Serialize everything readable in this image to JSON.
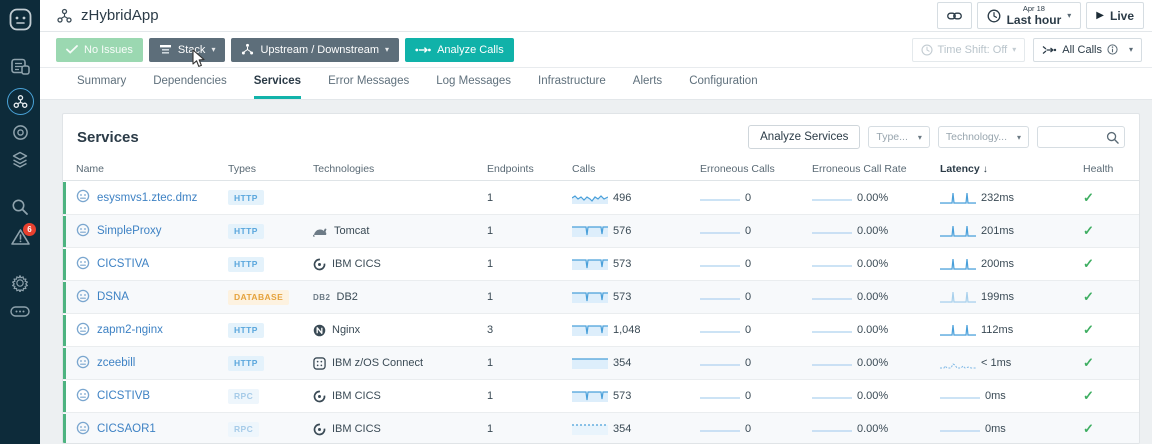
{
  "app": {
    "title": "zHybridApp"
  },
  "sidebar": {
    "icons": [
      "instana-logo",
      "dashboards-icon",
      "applications-icon",
      "websites-icon",
      "platform-icon",
      "analytics-icon",
      "events-icon",
      "settings-icon",
      "more-icon"
    ],
    "active_item": "applications",
    "events_badge": "6"
  },
  "topbar": {
    "link_icon": "link-icon",
    "time_date": "Apr 18",
    "time_range": "Last hour",
    "live_label": "Live"
  },
  "toolbar": {
    "no_issues_label": "No Issues",
    "stack_label": "Stack",
    "upstream_label": "Upstream / Downstream",
    "analyze_calls_label": "Analyze Calls",
    "time_shift_label": "Time Shift: Off",
    "all_calls_label": "All Calls"
  },
  "tabs": [
    {
      "label": "Summary",
      "active": false
    },
    {
      "label": "Dependencies",
      "active": false
    },
    {
      "label": "Services",
      "active": true
    },
    {
      "label": "Error Messages",
      "active": false
    },
    {
      "label": "Log Messages",
      "active": false
    },
    {
      "label": "Infrastructure",
      "active": false
    },
    {
      "label": "Alerts",
      "active": false
    },
    {
      "label": "Configuration",
      "active": false
    }
  ],
  "services_panel": {
    "title": "Services",
    "analyze_button": "Analyze Services",
    "type_filter_placeholder": "Type...",
    "technology_filter_placeholder": "Technology...",
    "columns": [
      "Name",
      "Types",
      "Technologies",
      "Endpoints",
      "Calls",
      "Erroneous Calls",
      "Erroneous Call Rate",
      "Latency",
      "Health"
    ],
    "sort_column": "Latency",
    "sort_direction": "desc",
    "rows": [
      {
        "name": "esysmvs1.ztec.dmz",
        "type": "HTTP",
        "type_kind": "http",
        "technology": "",
        "tech_icon": "",
        "endpoints": "1",
        "calls": "496",
        "calls_spark": "wavy",
        "erroneous_calls": "0",
        "erroneous_call_rate": "0.00%",
        "latency": "232ms",
        "latency_spark": "spikes",
        "health": "ok"
      },
      {
        "name": "SimpleProxy",
        "type": "HTTP",
        "type_kind": "http",
        "technology": "Tomcat",
        "tech_icon": "tomcat-icon",
        "endpoints": "1",
        "calls": "576",
        "calls_spark": "notch",
        "erroneous_calls": "0",
        "erroneous_call_rate": "0.00%",
        "latency": "201ms",
        "latency_spark": "spikes",
        "health": "ok"
      },
      {
        "name": "CICSTIVA",
        "type": "HTTP",
        "type_kind": "http",
        "technology": "IBM CICS",
        "tech_icon": "ibm-cics-icon",
        "endpoints": "1",
        "calls": "573",
        "calls_spark": "notch",
        "erroneous_calls": "0",
        "erroneous_call_rate": "0.00%",
        "latency": "200ms",
        "latency_spark": "spikes",
        "health": "ok"
      },
      {
        "name": "DSNA",
        "type": "DATABASE",
        "type_kind": "database",
        "technology": "DB2",
        "tech_icon": "db2-icon",
        "endpoints": "1",
        "calls": "573",
        "calls_spark": "notch",
        "erroneous_calls": "0",
        "erroneous_call_rate": "0.00%",
        "latency": "199ms",
        "latency_spark": "faint-spikes",
        "health": "ok"
      },
      {
        "name": "zapm2-nginx",
        "type": "HTTP",
        "type_kind": "http",
        "technology": "Nginx",
        "tech_icon": "nginx-icon",
        "endpoints": "3",
        "calls": "1,048",
        "calls_spark": "notch",
        "erroneous_calls": "0",
        "erroneous_call_rate": "0.00%",
        "latency": "112ms",
        "latency_spark": "spikes",
        "health": "ok"
      },
      {
        "name": "zceebill",
        "type": "HTTP",
        "type_kind": "http",
        "technology": "IBM z/OS Connect",
        "tech_icon": "zos-connect-icon",
        "endpoints": "1",
        "calls": "354",
        "calls_spark": "flat",
        "erroneous_calls": "0",
        "erroneous_call_rate": "0.00%",
        "latency": "< 1ms",
        "latency_spark": "bumps",
        "health": "ok"
      },
      {
        "name": "CICSTIVB",
        "type": "RPC",
        "type_kind": "rpc",
        "technology": "IBM CICS",
        "tech_icon": "ibm-cics-icon",
        "endpoints": "1",
        "calls": "573",
        "calls_spark": "notch",
        "erroneous_calls": "0",
        "erroneous_call_rate": "0.00%",
        "latency": "0ms",
        "latency_spark": "line",
        "health": "ok"
      },
      {
        "name": "CICSAOR1",
        "type": "RPC",
        "type_kind": "rpc",
        "technology": "IBM CICS",
        "tech_icon": "ibm-cics-icon",
        "endpoints": "1",
        "calls": "354",
        "calls_spark": "dotted",
        "erroneous_calls": "0",
        "erroneous_call_rate": "0.00%",
        "latency": "0ms",
        "latency_spark": "line",
        "health": "ok"
      }
    ]
  },
  "colors": {
    "sidebar_bg": "#0d2b3a",
    "accent_teal": "#12b3aa",
    "link_blue": "#3e82c4",
    "spark_blue": "#4aa0da",
    "health_green": "#3fae62",
    "row_health_bar": "#4db380",
    "badge_red": "#e8402e",
    "button_dark": "#5d6e7a",
    "button_green": "#9bd8b1"
  }
}
